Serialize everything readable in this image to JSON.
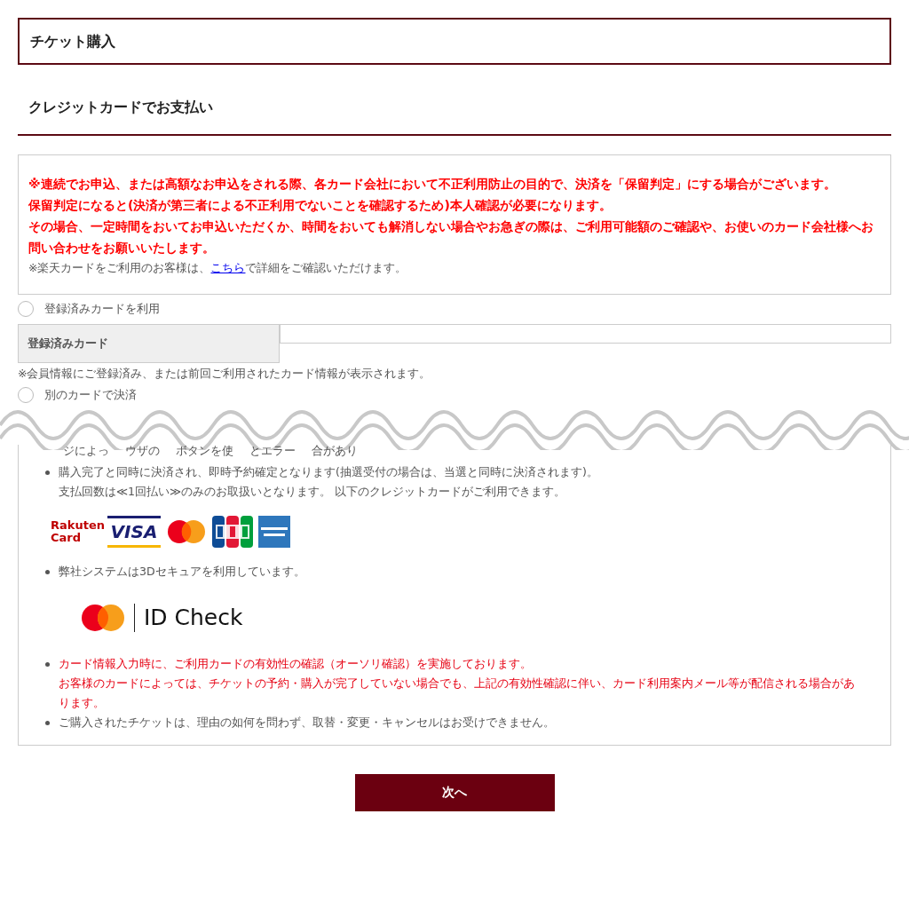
{
  "page_title": "チケット購入",
  "section_heading": "クレジットカードでお支払い",
  "notice": {
    "warnings": [
      "※連続でお申込、または高額なお申込をされる際、各カード会社において不正利用防止の目的で、決済を「保留判定」にする場合がございます。",
      "保留判定になると(決済が第三者による不正利用でないことを確認するため)本人確認が必要になります。",
      "その場合、一定時間をおいてお申込いただくか、時間をおいても解消しない場合やお急ぎの際は、ご利用可能額のご確認や、お使いのカード会社様へお問い合わせをお願いいたします。"
    ],
    "info_before": "※楽天カードをご利用のお客様は、",
    "info_link": "こちら",
    "info_after": "で詳細をご確認いただけます。"
  },
  "payment_options": [
    {
      "label": "登録済みカードを利用",
      "selected": false
    },
    {
      "label": "別のカードで決済",
      "selected": false
    }
  ],
  "registered_card": {
    "label": "登録済みカード",
    "note": "※会員情報にご登録済み、または前回ご利用されたカード情報が表示されます。"
  },
  "partial_line_fragments": [
    "ジによっ",
    "ウザの",
    "ボタンを使",
    "とエラー",
    "合があり"
  ],
  "info_items": [
    {
      "kind": "text",
      "emphasis": false,
      "lines": [
        "購入完了と同時に決済され、即時予約確定となります(抽選受付の場合は、当選と同時に決済されます)。",
        "支払回数は≪1回払い≫のみのお取扱いとなります。 以下のクレジットカードがご利用できます。"
      ]
    },
    {
      "kind": "card_logos",
      "logo_texts": [
        "Rakuten",
        "Card",
        "VISA"
      ]
    },
    {
      "kind": "text",
      "emphasis": false,
      "lines": [
        "弊社システムは3Dセキュアを利用しています。"
      ]
    },
    {
      "kind": "id_check",
      "logo_text": "ID Check"
    },
    {
      "kind": "text",
      "emphasis": true,
      "lines": [
        "カード情報入力時に、ご利用カードの有効性の確認（オーソリ確認）を実施しております。",
        "お客様のカードによっては、チケットの予約・購入が完了していない場合でも、上記の有効性確認に伴い、カード利用案内メール等が配信される場合があります。"
      ]
    },
    {
      "kind": "text",
      "emphasis": false,
      "lines": [
        "ご購入されたチケットは、理由の如何を問わず、取替・変更・キャンセルはお受けできません。"
      ]
    }
  ],
  "next_button": "次へ"
}
